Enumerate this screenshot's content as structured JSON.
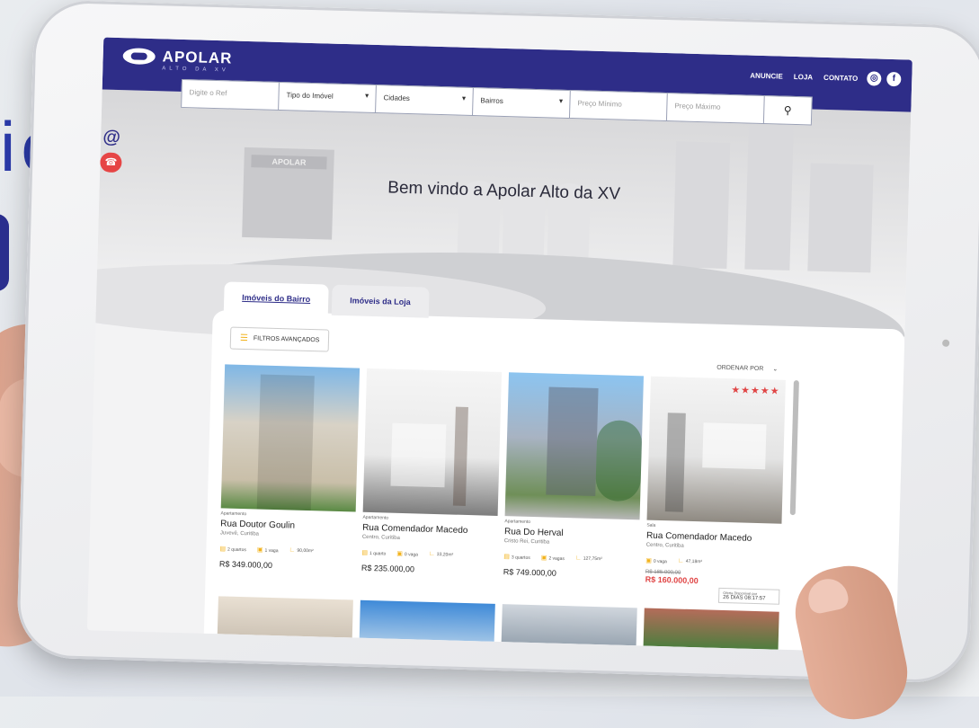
{
  "background": {
    "headline_fragment": "io"
  },
  "nav": {
    "logo_name": "APOLAR",
    "logo_sub": "ALTO DA XV",
    "links": [
      "ANUNCIE",
      "LOJA",
      "CONTATO"
    ]
  },
  "search": {
    "code_placeholder": "Digite o Ref",
    "type_label": "Tipo do Imóvel",
    "city_label": "Cidades",
    "district_label": "Bairros",
    "min_price_placeholder": "Preço Mínimo",
    "max_price_placeholder": "Preço Máximo"
  },
  "hero": {
    "store_sign": "APOLAR",
    "welcome": "Bem vindo a Apolar Alto da XV"
  },
  "tabs": [
    "Imóveis do Bairro",
    "Imóveis da Loja"
  ],
  "filters_label": "FILTROS AVANÇADOS",
  "order_label": "ORDENAR POR",
  "cards": [
    {
      "type": "Apartamento",
      "street": "Rua Doutor Goulin",
      "location": "Juvevê, Curitiba",
      "features": [
        "2 quartos",
        "1 vaga",
        "90,00m²"
      ],
      "price": "R$ 349.000,00"
    },
    {
      "type": "Apartamento",
      "street": "Rua Comendador Macedo",
      "location": "Centro, Curitiba",
      "features": [
        "1 quarto",
        "0 vaga",
        "33,20m²"
      ],
      "price": "R$ 235.000,00"
    },
    {
      "type": "Apartamento",
      "street": "Rua Do Herval",
      "location": "Cristo Rei, Curitiba",
      "features": [
        "3 quartos",
        "2 vagas",
        "127,75m²"
      ],
      "price": "R$ 749.000,00"
    },
    {
      "type": "Sala",
      "street": "Rua Comendador Macedo",
      "location": "Centro, Curitiba",
      "features": [
        "0 vaga",
        "47,18m²"
      ],
      "old_price": "R$ 185.000,00",
      "price": "R$ 160.000,00",
      "stars": "★★★★★",
      "offer_label": "Oferta Disponível por",
      "countdown": "26 DIAS 08:17:57"
    }
  ]
}
